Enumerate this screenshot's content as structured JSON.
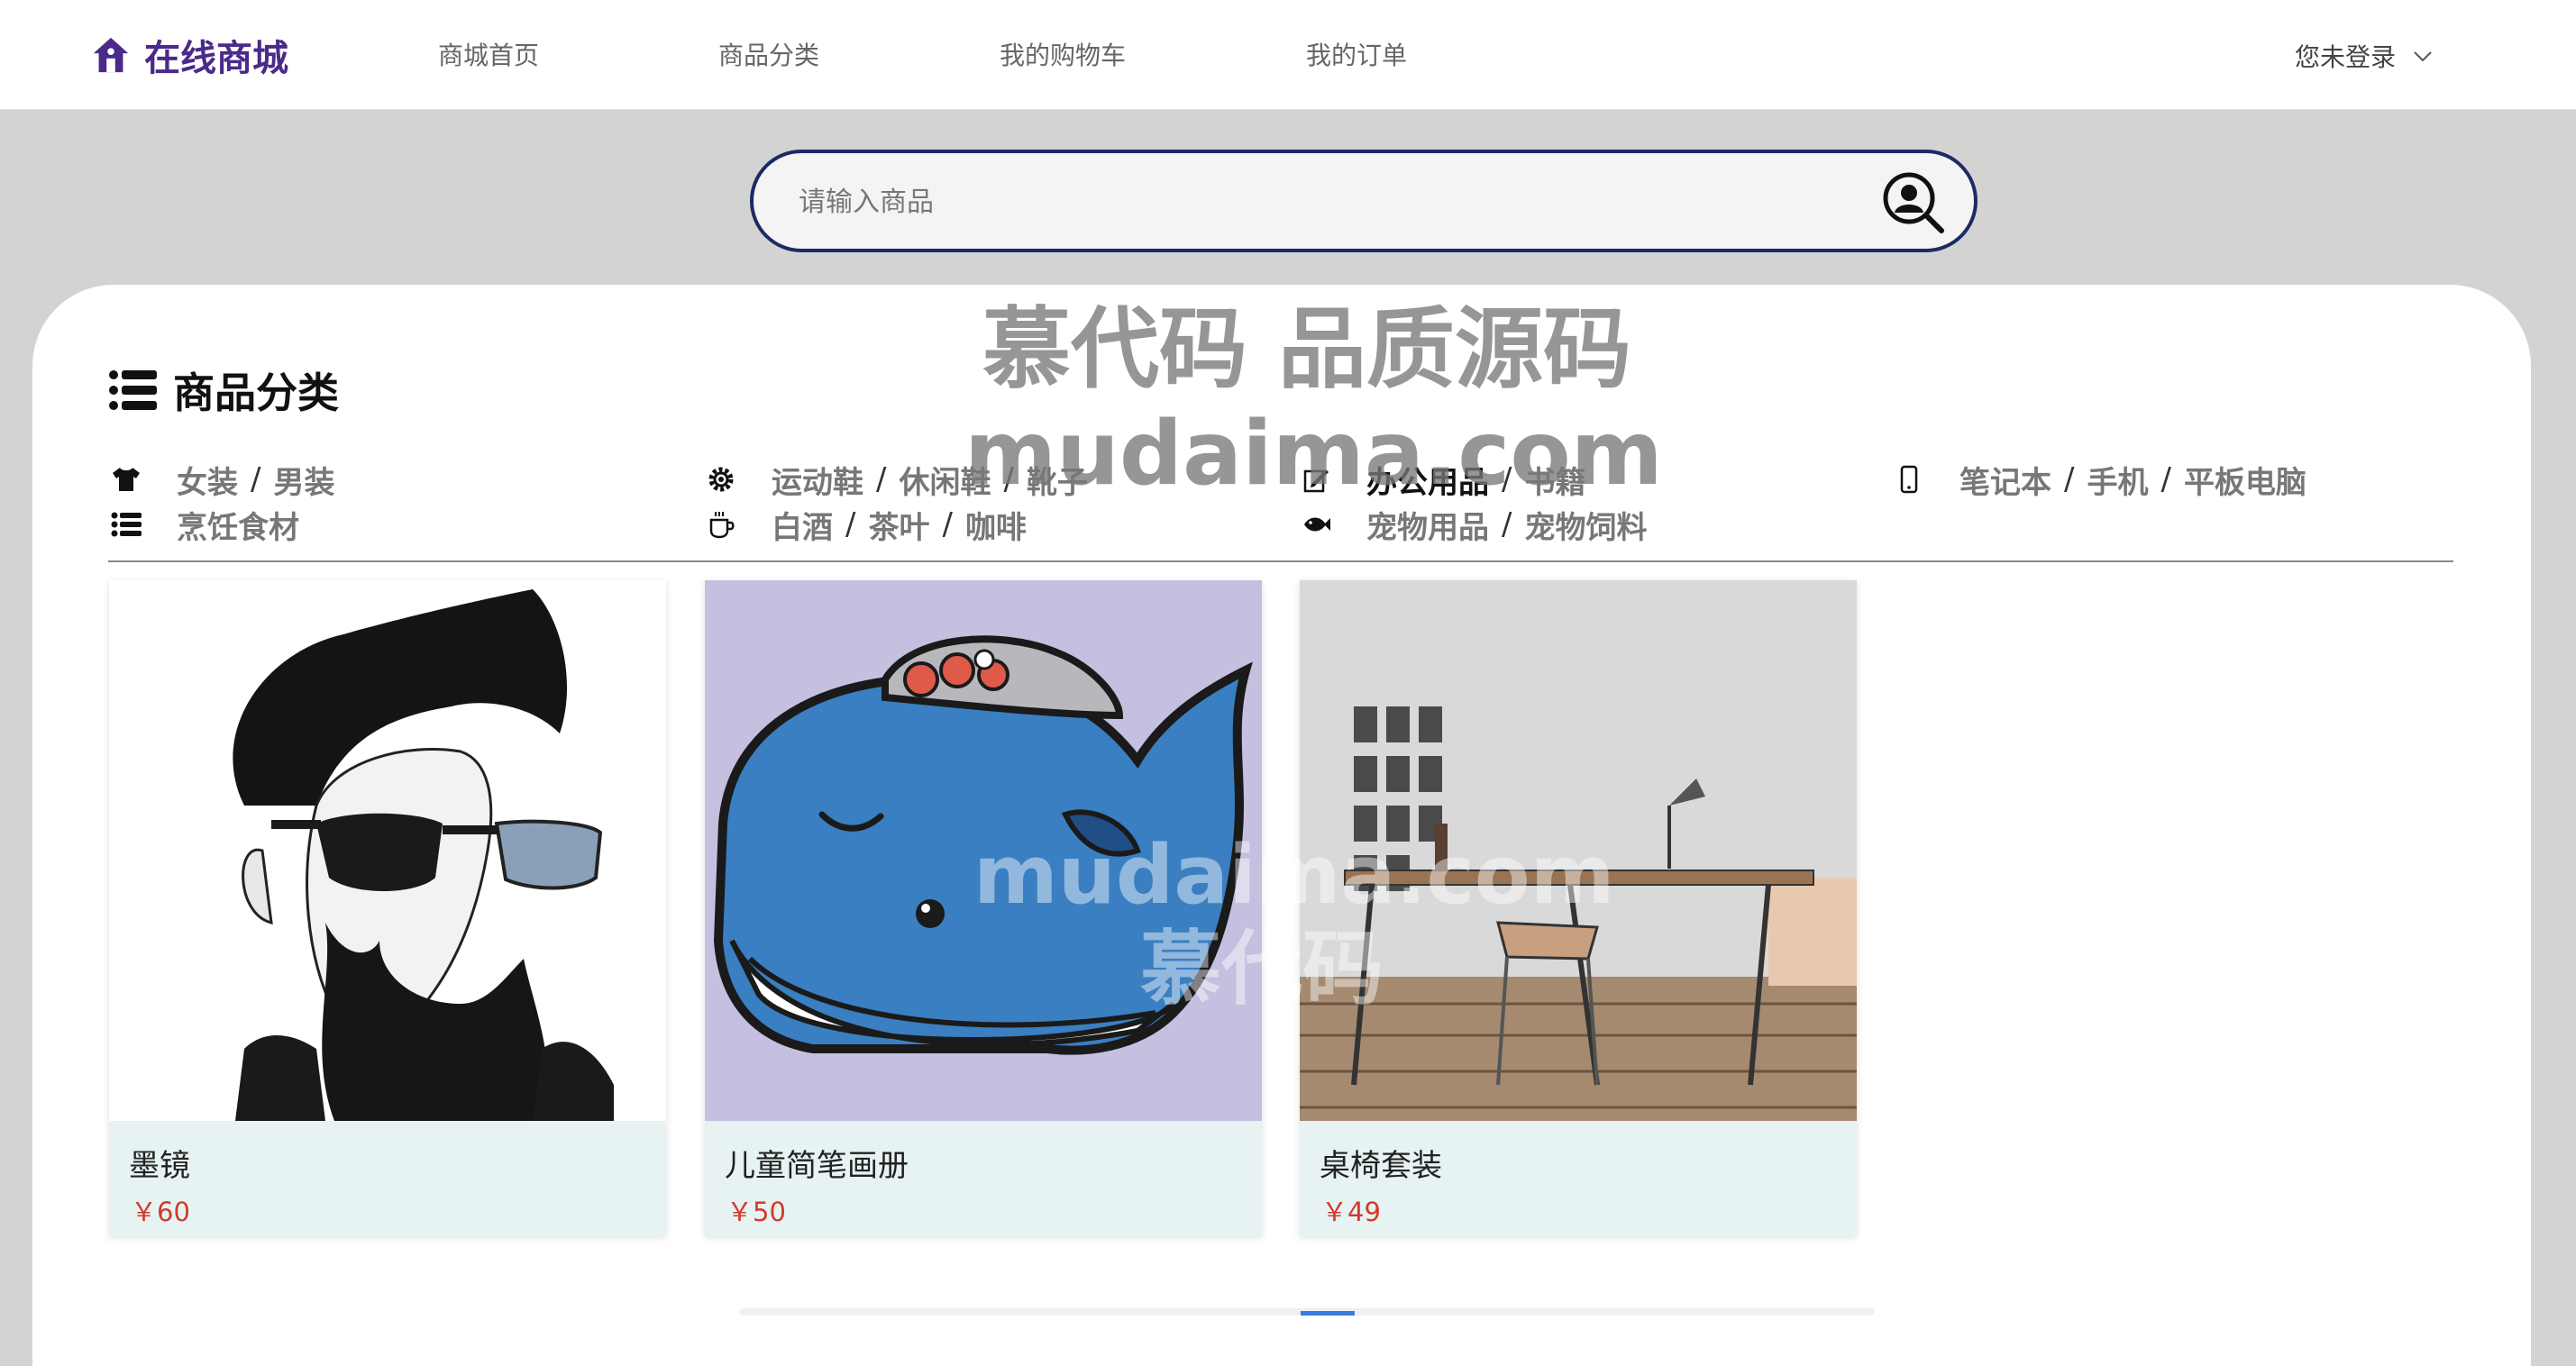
{
  "header": {
    "brand": "在线商城",
    "nav": [
      "商城首页",
      "商品分类",
      "我的购物车",
      "我的订单"
    ],
    "user_menu": "您未登录"
  },
  "search": {
    "placeholder": "请输入商品",
    "value": ""
  },
  "watermark": {
    "line1": "慕代码 品质源码",
    "line2": "mudaima.com",
    "inner1": "mudaima.com",
    "inner2": "慕代码"
  },
  "categories": {
    "title": "商品分类",
    "groups": [
      {
        "icon": "tshirt-icon",
        "items": [
          "女装",
          "男装"
        ]
      },
      {
        "icon": "gear-icon",
        "items": [
          "运动鞋",
          "休闲鞋",
          "靴子"
        ]
      },
      {
        "icon": "edit-icon",
        "items": [
          "办公用品",
          "书籍"
        ]
      },
      {
        "icon": "mobile-icon",
        "items": [
          "笔记本",
          "手机",
          "平板电脑"
        ]
      },
      {
        "icon": "list-icon",
        "items": [
          "烹饪食材"
        ]
      },
      {
        "icon": "coffee-icon",
        "items": [
          "白酒",
          "茶叶",
          "咖啡"
        ]
      },
      {
        "icon": "fish-icon",
        "items": [
          "宠物用品",
          "宠物饲料"
        ]
      }
    ]
  },
  "products": [
    {
      "name": "墨镜",
      "price": "￥60"
    },
    {
      "name": "儿童简笔画册",
      "price": "￥50"
    },
    {
      "name": "桌椅套装",
      "price": "￥49"
    }
  ],
  "colors": {
    "brand": "#4a2a8a",
    "search_border": "#1c2a66",
    "price": "#d23a2a",
    "card_bg": "#e6f3f2"
  }
}
